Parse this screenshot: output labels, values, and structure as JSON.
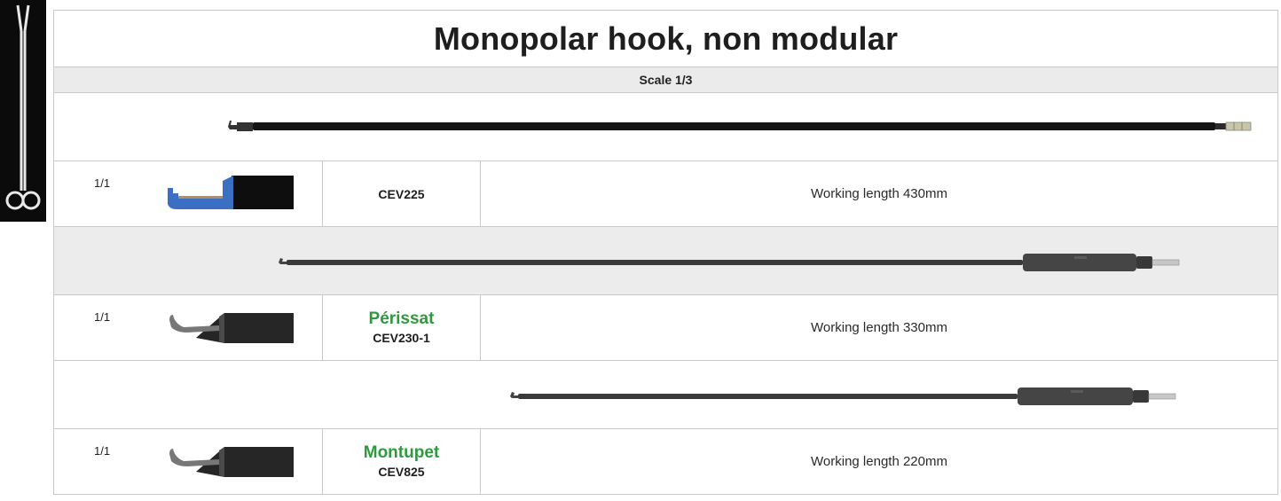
{
  "sidebar": {
    "icon": "scissors-icon",
    "background": "#0b0b0b"
  },
  "title": "Monopolar hook, non modular",
  "scale_label": "Scale 1/3",
  "brand_color": "#2e9a3d",
  "products": [
    {
      "ratio": "1/1",
      "brand": "",
      "code": "CEV225",
      "working_length": "Working length 430mm",
      "tip_color": "#3b6fc4"
    },
    {
      "ratio": "1/1",
      "brand": "Périssat",
      "code": "CEV230-1",
      "working_length": "Working length 330mm",
      "tip_color": "#6e6e6e"
    },
    {
      "ratio": "1/1",
      "brand": "Montupet",
      "code": "CEV825",
      "working_length": "Working length 220mm",
      "tip_color": "#6e6e6e"
    }
  ]
}
